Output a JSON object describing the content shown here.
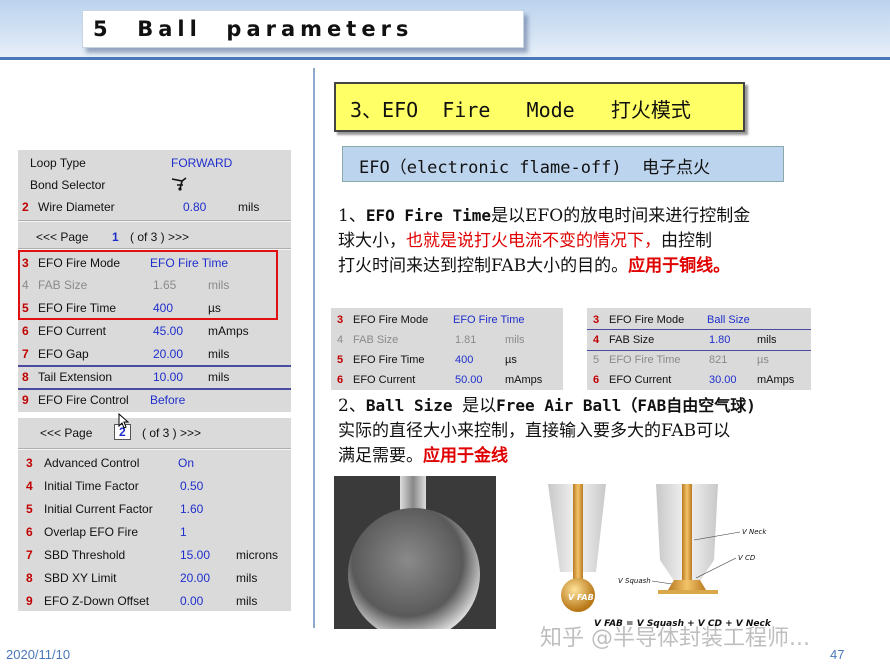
{
  "header": {
    "title": "5  Ball  parameters"
  },
  "panel1": {
    "rows_top": [
      {
        "num": "",
        "label": "Loop Type",
        "value": "FORWARD",
        "unit": ""
      },
      {
        "num": "",
        "label": "Bond Selector",
        "value": "",
        "unit": ""
      },
      {
        "num": "2",
        "label": "Wire Diameter",
        "value": "0.80",
        "unit": "mils"
      }
    ],
    "pager": {
      "prefix": "<<<  Page",
      "page": "1",
      "suffix": "( of 3 )  >>>"
    },
    "rows": [
      {
        "num": "3",
        "label": "EFO Fire Mode",
        "value": "EFO Fire Time",
        "unit": ""
      },
      {
        "num": "4",
        "label": "FAB Size",
        "value": "1.65",
        "unit": "mils"
      },
      {
        "num": "5",
        "label": "EFO Fire Time",
        "value": "400",
        "unit": "µs"
      },
      {
        "num": "6",
        "label": "EFO Current",
        "value": "45.00",
        "unit": "mAmps"
      },
      {
        "num": "7",
        "label": "EFO Gap",
        "value": "20.00",
        "unit": "mils"
      },
      {
        "num": "8",
        "label": "Tail Extension",
        "value": "10.00",
        "unit": "mils"
      },
      {
        "num": "9",
        "label": "EFO Fire Control",
        "value": "Before",
        "unit": ""
      }
    ]
  },
  "panel2": {
    "pager": {
      "prefix": "<<<  Page",
      "page": "2",
      "suffix": "( of 3 )  >>>"
    },
    "rows": [
      {
        "num": "3",
        "label": "Advanced Control",
        "value": "On",
        "unit": ""
      },
      {
        "num": "4",
        "label": "Initial Time Factor",
        "value": "0.50",
        "unit": ""
      },
      {
        "num": "5",
        "label": "Initial Current Factor",
        "value": "1.60",
        "unit": ""
      },
      {
        "num": "6",
        "label": "Overlap EFO Fire",
        "value": "1",
        "unit": ""
      },
      {
        "num": "7",
        "label": "SBD Threshold",
        "value": "15.00",
        "unit": "microns"
      },
      {
        "num": "8",
        "label": "SBD XY Limit",
        "value": "20.00",
        "unit": "mils"
      },
      {
        "num": "9",
        "label": "EFO Z-Down Offset",
        "value": "0.00",
        "unit": "mils"
      }
    ]
  },
  "title3": "3、EFO  Fire   Mode   打火模式",
  "efo_box": "EFO（electronic flame-off)  电子点火",
  "para1": {
    "l1a": "1、",
    "l1b": "EFO Fire Time",
    "l1c": "是以EFO的放电时间来进行控制金",
    "l2a": "球大小，",
    "l2b": "也就是说打火电流不变的情况下，",
    "l2c": "由控制",
    "l3a": "打火时间来达到控制FAB大小的目的。",
    "l3b": "应用于铜线。"
  },
  "mini1": {
    "rows": [
      {
        "num": "3",
        "label": "EFO Fire Mode",
        "value": "EFO Fire Time",
        "unit": ""
      },
      {
        "num": "4",
        "label": "FAB Size",
        "value": "1.81",
        "unit": "mils"
      },
      {
        "num": "5",
        "label": "EFO Fire Time",
        "value": "400",
        "unit": "µs"
      },
      {
        "num": "6",
        "label": "EFO Current",
        "value": "50.00",
        "unit": "mAmps"
      }
    ]
  },
  "mini2": {
    "rows": [
      {
        "num": "3",
        "label": "EFO Fire Mode",
        "value": "Ball Size",
        "unit": ""
      },
      {
        "num": "4",
        "label": "FAB Size",
        "value": "1.80",
        "unit": "mils"
      },
      {
        "num": "5",
        "label": "EFO Fire Time",
        "value": "821",
        "unit": "µs"
      },
      {
        "num": "6",
        "label": "EFO Current",
        "value": "30.00",
        "unit": "mAmps"
      }
    ]
  },
  "para2": {
    "l1a": "2、",
    "l1b": "Ball Size ",
    "l1c": "是以",
    "l1d": "Free Air Ball（FAB自由空气球)",
    "l2": "实际的直径大小来控制，直接输入要多大的FAB可以",
    "l3a": "满足需要。",
    "l3b": "应用于金线"
  },
  "diagram": {
    "label_fab": "V FAB",
    "label_squash": "V Squash",
    "label_cd": "V CD",
    "label_neck": "V Neck",
    "formula": "V FAB = V Squash + V CD + V Neck"
  },
  "footer": {
    "date": "2020/11/10",
    "page": "47"
  },
  "watermark": "知乎 @半导体封装工程师..."
}
